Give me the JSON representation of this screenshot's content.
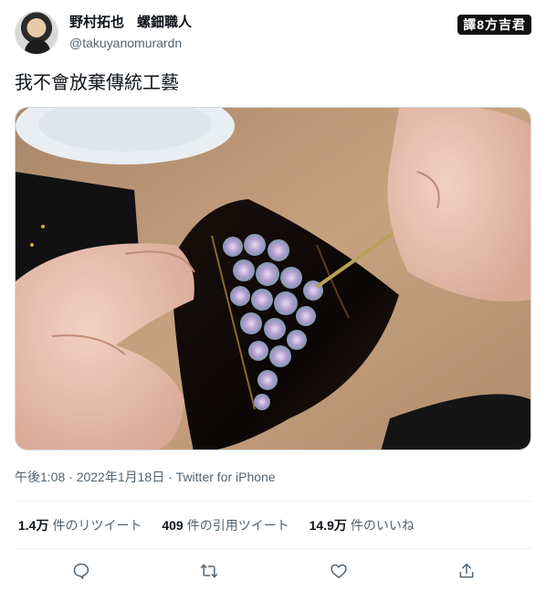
{
  "author": {
    "display_name": "野村拓也",
    "display_name_sub": "螺鈿職人",
    "handle": "@takuyanomurardn"
  },
  "watermark": "譯8方吉君",
  "tweet": {
    "text": "我不會放棄傳統工藝"
  },
  "meta": {
    "time": "午後1:08",
    "separator": "·",
    "date": "2022年1月18日",
    "client": "Twitter for iPhone"
  },
  "stats": {
    "retweets": {
      "count": "1.4万",
      "label": "件のリツイート"
    },
    "quotes": {
      "count": "409",
      "label": "件の引用ツイート"
    },
    "likes": {
      "count": "14.9万",
      "label": "件のいいね"
    }
  },
  "actions": [
    {
      "icon": "reply-icon"
    },
    {
      "icon": "retweet-icon"
    },
    {
      "icon": "like-icon"
    },
    {
      "icon": "share-icon"
    }
  ],
  "colors": {
    "text": "#0f1419",
    "secondary": "#536471",
    "divider": "#eff3f4"
  }
}
